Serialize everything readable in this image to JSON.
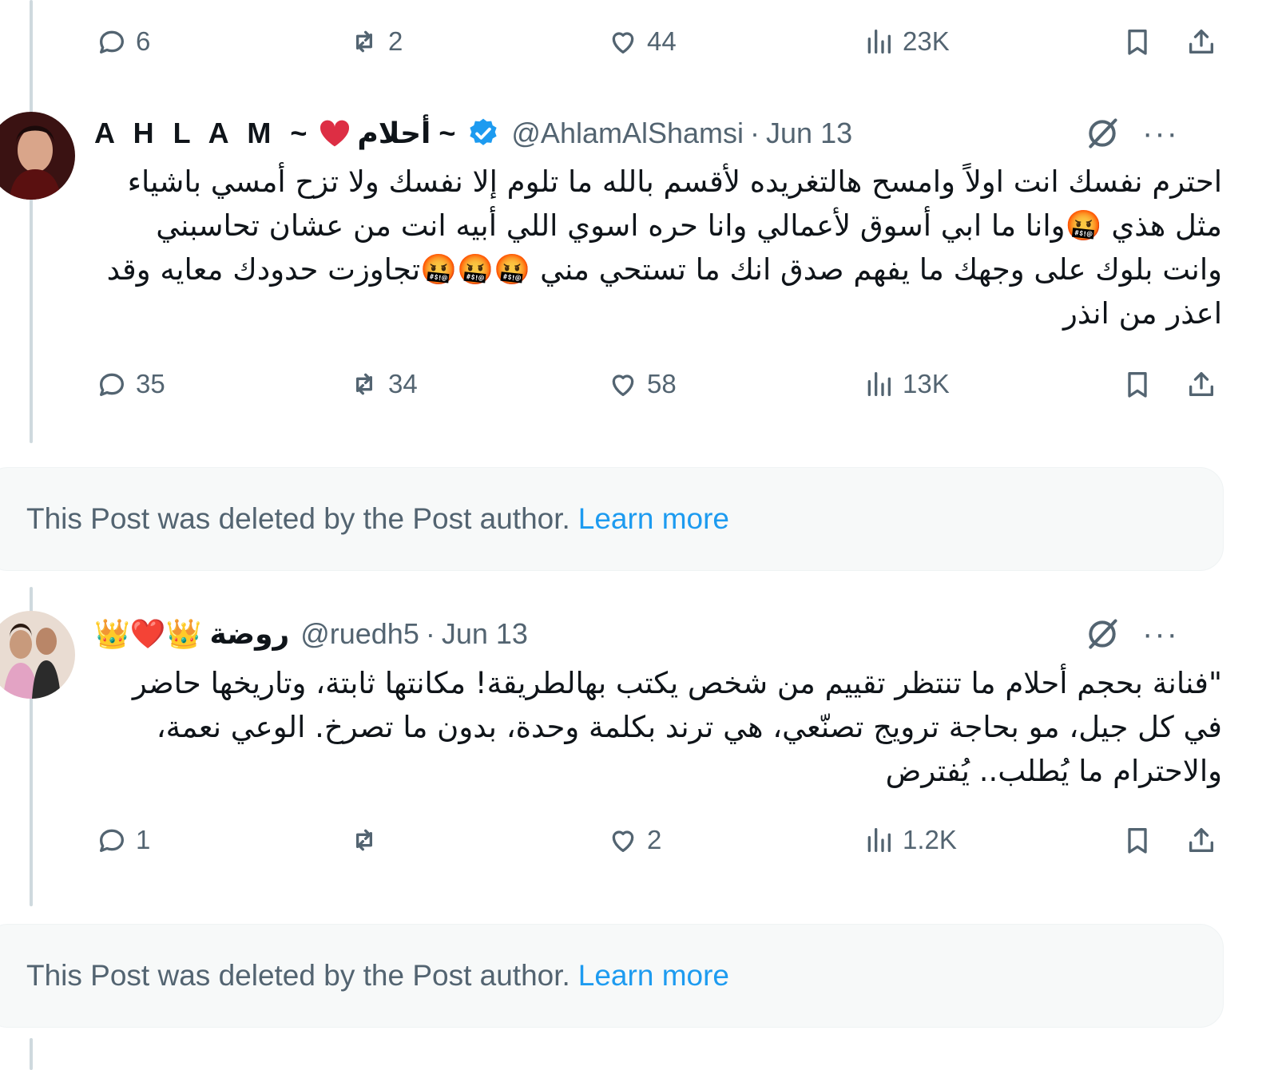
{
  "posts": [
    {
      "stats": {
        "replies": "6",
        "reposts": "2",
        "likes": "44",
        "views": "23K"
      }
    },
    {
      "author": {
        "latin_name": "A H L A M ~",
        "arabic_name": "~ أحلام",
        "handle": "@AhlamAlShamsi",
        "separator": "·",
        "date": "Jun 13",
        "verified": true
      },
      "text": "احترم نفسك انت اولاً وامسح هالتغريده لأقسم بالله ما تلوم إلا نفسك ولا تزح أمسي باشياء مثل هذي 🤬وانا ما ابي أسوق لأعمالي وانا حره اسوي اللي أبيه انت من عشان تحاسبني وانت بلوك على وجهك ما يفهم صدق انك ما تستحي مني 🤬🤬🤬تجاوزت حدودك معايه وقد اعذر من انذر",
      "stats": {
        "replies": "35",
        "reposts": "34",
        "likes": "58",
        "views": "13K"
      }
    },
    {
      "author": {
        "name": "روضة 👑❤️👑",
        "handle": "@ruedh5",
        "separator": "·",
        "date": "Jun 13"
      },
      "text": "\"فنانة بحجم أحلام ما تنتظر تقييم من شخص يكتب بهالطريقة! مكانتها ثابتة، وتاريخها حاضر في كل جيل، مو بحاجة ترويج تصنّعي، هي ترند بكلمة وحدة، بدون ما تصرخ. الوعي نعمة، والاحترام ما يُطلب.. يُفترض",
      "stats": {
        "replies": "1",
        "reposts": "",
        "likes": "2",
        "views": "1.2K"
      }
    }
  ],
  "deleted_notice": {
    "text": "This Post was deleted by the Post author.",
    "link": "Learn more"
  },
  "more_label": "···",
  "colors": {
    "accent": "#1d9bf0",
    "muted": "#536471",
    "text": "#0f1419",
    "thread_line": "#cfd9de",
    "deleted_bg": "#f7f9f9"
  },
  "icons": [
    "reply-icon",
    "repost-icon",
    "like-icon",
    "views-icon",
    "bookmark-icon",
    "share-icon",
    "grok-icon",
    "more-icon",
    "verified-badge-icon"
  ]
}
